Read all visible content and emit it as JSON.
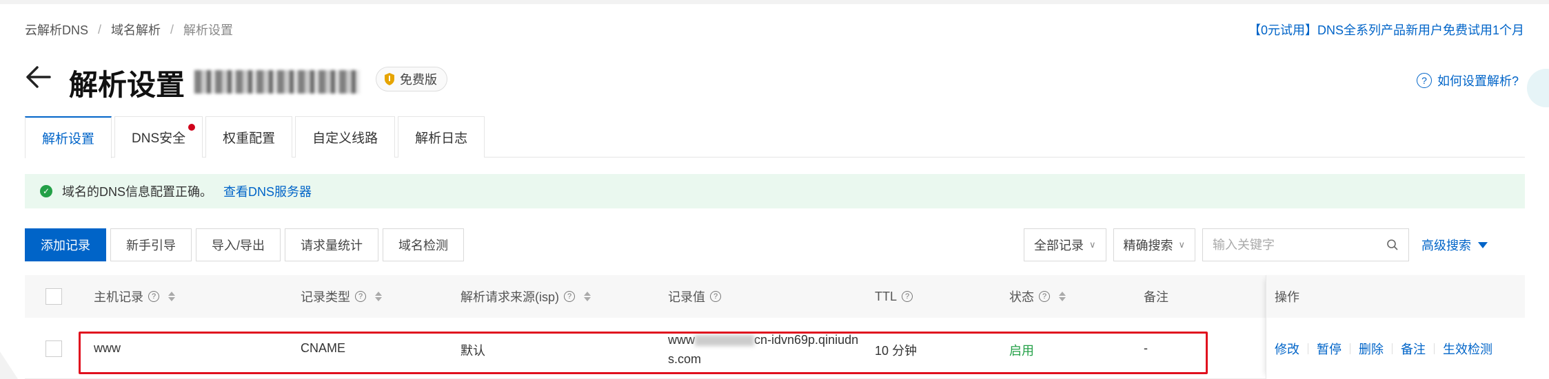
{
  "breadcrumb": [
    "云解析DNS",
    "域名解析",
    "解析设置"
  ],
  "promo": "【0元试用】DNS全系列产品新用户免费试用1个月",
  "page": {
    "title": "解析设置",
    "edition": "免费版",
    "help": "如何设置解析?"
  },
  "tabs": [
    {
      "label": "解析设置",
      "active": true
    },
    {
      "label": "DNS安全",
      "dot": true
    },
    {
      "label": "权重配置"
    },
    {
      "label": "自定义线路"
    },
    {
      "label": "解析日志"
    }
  ],
  "alert": {
    "text": "域名的DNS信息配置正确。",
    "link": "查看DNS服务器"
  },
  "toolbar": [
    "添加记录",
    "新手引导",
    "导入/导出",
    "请求量统计",
    "域名检测"
  ],
  "filters": {
    "record_filter": "全部记录",
    "match_mode": "精确搜索",
    "search_placeholder": "输入关键字",
    "advanced": "高级搜索"
  },
  "columns": [
    "主机记录",
    "记录类型",
    "解析请求来源(isp)",
    "记录值",
    "TTL",
    "状态",
    "备注",
    "操作"
  ],
  "rows": [
    {
      "host": "www",
      "type": "CNAME",
      "isp": "默认",
      "value_prefix": "www",
      "value_suffix": "cn-idvn69p.qiniudn",
      "value_line2": "s.com",
      "ttl": "10 分钟",
      "status": "启用",
      "remark": "-"
    }
  ],
  "row_ops": [
    "修改",
    "暂停",
    "删除",
    "备注",
    "生效检测"
  ],
  "colors": {
    "accent": "#0064c8",
    "success": "#23a047",
    "highlight": "#e0101e",
    "alert_bg": "#eaf8ef"
  }
}
